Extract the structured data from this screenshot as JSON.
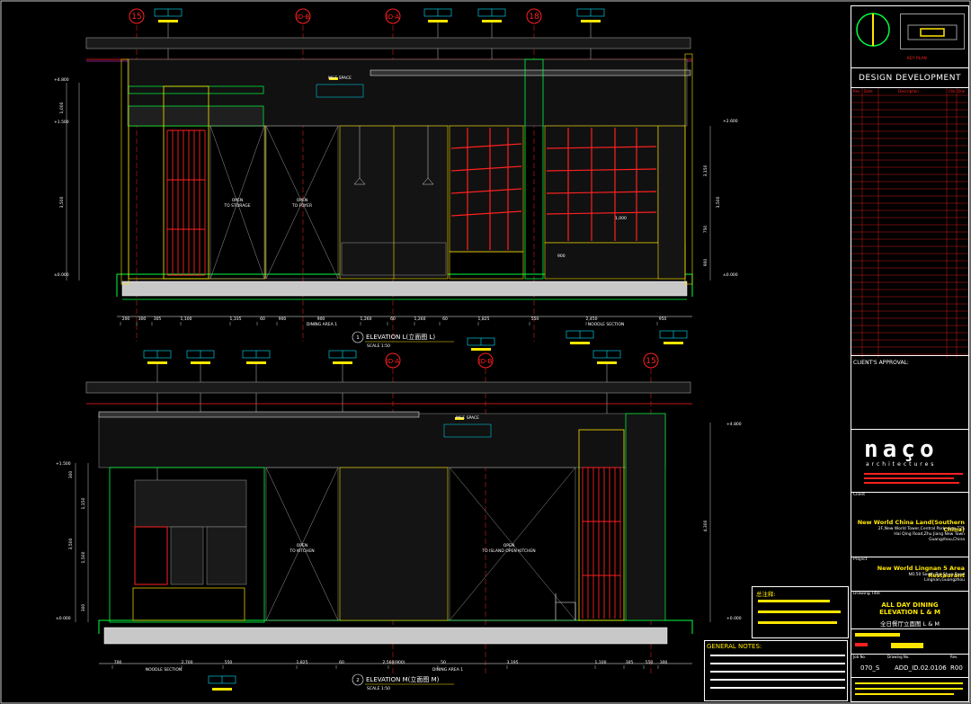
{
  "drawing": {
    "elevation_l": {
      "number": "1",
      "title": "ELEVATION L(立面图 L)",
      "scale": "SCALE 1:50"
    },
    "elevation_m": {
      "number": "2",
      "title": "ELEVATION M(立面图 M)",
      "scale": "SCALE 1:50"
    },
    "grid_top": [
      "15",
      "ID-B",
      "ID-A",
      "18"
    ],
    "grid_bottom": [
      "ID-A",
      "ID-B",
      "15"
    ],
    "notes_top": {
      "open_storage": "OPEN\nTO STORAGE",
      "open_foyer": "OPEN\nTO FOYER",
      "mep_space": "M&E SPACE"
    },
    "notes_bottom": {
      "open_kitchen": "OPEN\nTO KITCHEN",
      "open_island": "OPEN\nTO ISLAND OPEN KITCHEN",
      "mep_space": "M&E SPACE"
    },
    "dims_top": [
      "200",
      "300",
      "305",
      "1,100",
      "1,335",
      "60",
      "900",
      "900",
      "1,260",
      "60",
      "1,260",
      "60",
      "1,825",
      "550",
      "2,450",
      "950"
    ],
    "dims_bottom": [
      "700",
      "2,700",
      "550",
      "1,825",
      "60",
      "2,560(900)",
      "50",
      "3,195",
      "1,100",
      "305",
      "550",
      "300"
    ],
    "section_labels_top": [
      "DINING AREA 1",
      "NOODLE SECTION"
    ],
    "section_labels_bottom": [
      "NOODLE SECTION",
      "DINING AREA 1"
    ],
    "levels_top": [
      "+4.800",
      "+1.500",
      "±0.000",
      "+2.600",
      "±0.000"
    ],
    "levels_bottom": [
      "+4.800",
      "+1.500",
      "±0.000",
      "+0.000"
    ],
    "vert_dims_l": [
      "1,000",
      "3,500"
    ],
    "vert_dims_r": [
      "3,150",
      "3,500",
      "750",
      "900"
    ],
    "vert_dims_mb": [
      "300",
      "1,150",
      "3,500",
      "1,500",
      "300"
    ],
    "vert_dims_mr": [
      "4,300"
    ],
    "small_dims": [
      "1,000",
      "900"
    ]
  },
  "title_block": {
    "key_plan_label": "KEY PLAN",
    "stage": "DESIGN DEVELOPMENT",
    "rev_headers": [
      "Rev",
      "Date",
      "Description",
      "Chk",
      "Drw"
    ],
    "clients_approval": "CLIENT'S APPROVAL:",
    "logo": "naço",
    "logo_sub": "architectures",
    "client_label": "Client",
    "client_name": "New World China Land(Southern China)",
    "client_addr": "2F,New World Tower,Central Park-view,T25\nHai Qing Road,Zhu Jiang New Town\nGuangzhou,China",
    "project_label": "Project",
    "project_name": "New World Lingnan 5 Area Restaurant",
    "project_addr": "NO.50 South Bai Shun Road\nLingnan,Guangzhou",
    "drawing_title_label": "Drawing Title",
    "drawing_title": "ALL DAY DINING\nELEVATION  L & M",
    "drawing_title_cn": "全日餐厅立面图  L & M",
    "job_no_label": "Job No.",
    "drawing_no_label": "Drawing No.",
    "rev_label": "Rev.",
    "job_no": "070_S",
    "drawing_no": "ADD_ID.02.0106",
    "rev": "R00",
    "general_notes": "GENERAL NOTES:",
    "cn_notes_title": "总注释:"
  },
  "colors": {
    "outline": "#00ff40",
    "wall": "#ffe600",
    "red": "#ff2020",
    "cyan": "#00e5ff",
    "white": "#ffffff",
    "grey": "#9a9a9a",
    "magenta": "#ff40ff"
  }
}
